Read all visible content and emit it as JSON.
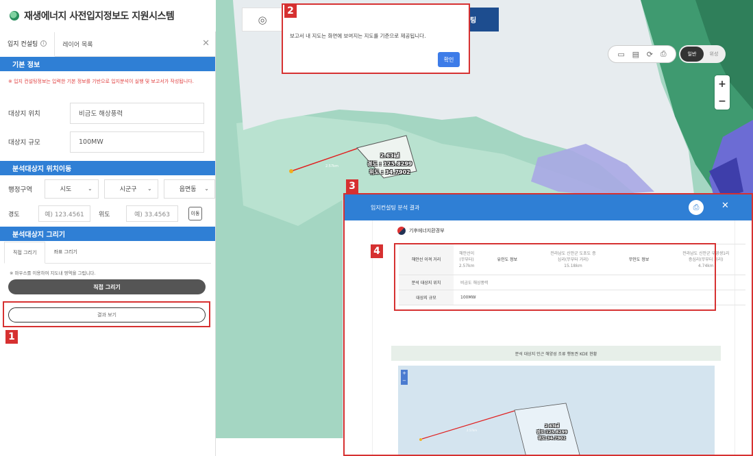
{
  "app": {
    "title": "재생에너지 사전입지정보도 지원시스템"
  },
  "sidebar": {
    "tabs": [
      {
        "label": "입지 컨설팅"
      },
      {
        "label": "레이어 목록"
      }
    ],
    "basic_section": "기본 정보",
    "notice": "※ 입지 컨설팅정보는 입력한 기본 정보를 기반으로 입지분석이 실행 및 보고서가 작성됩니다.",
    "site_location_label": "대상지 위치",
    "site_location_value": "비금도 해상풍력",
    "site_scale_label": "대상지 규모",
    "site_scale_value": "100MW",
    "move_section": "분석대상지 위치이동",
    "admin_label": "행정구역",
    "selects": [
      "시도",
      "시군구",
      "읍면동"
    ],
    "lon_label": "경도",
    "lon_placeholder": "예) 123.4561",
    "lat_label": "위도",
    "lat_placeholder": "예) 33.4563",
    "move_button": "이동",
    "draw_section": "분석대상지 그리기",
    "draw_tabs": [
      "직접 그리기",
      "좌표 그리기"
    ],
    "draw_hint": "※ 마우스를 이용하여 지도내 영역을 그립니다.",
    "draw_button": "직접 그리기",
    "result_button": "결과 보기"
  },
  "map": {
    "top_tab_blue": "팅",
    "dialog": {
      "message": "보고서 내 지도는 화면에 보여지는 지도를 기준으로 제공됩니다.",
      "confirm": "확인"
    },
    "map_type": {
      "on": "일반",
      "off": "위성"
    },
    "polygon": {
      "area": "2.63㎢",
      "lon": "경도 : 125.8299",
      "lat": "위도 : 34.7902"
    }
  },
  "callouts": [
    "1",
    "2",
    "3",
    "4"
  ],
  "result_panel": {
    "title": "입지컨설팅 분석 결과",
    "agency": "기후에너지환경부",
    "table": {
      "row1": {
        "h1": "해안선 이격 거리",
        "v1a": "해안선이",
        "v1b": "(무부터)",
        "v1c": "2.57km",
        "h2": "유인도 정보",
        "v2a": "전라남도 신안군 도초도 증",
        "v2b": "심리(무부터 거리)",
        "v2c": "15.18km",
        "h3": "무인도 정보",
        "v3a": "전라남도 신안군 우영생1리",
        "v3b": "증심리(무부터 거리)",
        "v3c": "4.74km"
      },
      "row2": {
        "h": "분석 대상지 위치",
        "v": "비금도 해상풍력"
      },
      "row3": {
        "h": "대상지 규모",
        "v": "100MW"
      }
    },
    "kde_title": "분석 대상지 인근 해양성 조류 행동권 KDE 현황",
    "mini_polygon": {
      "area": "2.63㎢",
      "lon": "경도:125.8299",
      "lat": "위도:34.7902"
    }
  },
  "colors": {
    "accent_blue": "#2f7fd5",
    "callout_red": "#d63030",
    "sea_green": "#b8ddcf"
  }
}
